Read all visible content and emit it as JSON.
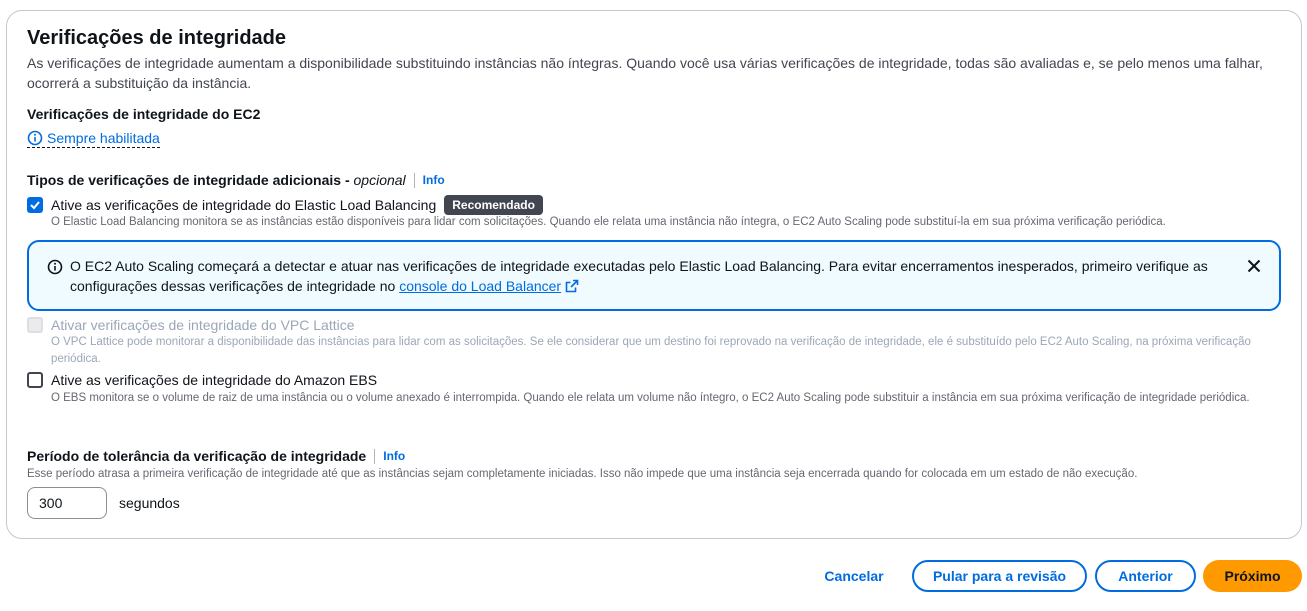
{
  "section": {
    "title": "Verificações de integridade",
    "description": "As verificações de integridade aumentam a disponibilidade substituindo instâncias não íntegras. Quando você usa várias verificações de integridade, todas são avaliadas e, se pelo menos uma falhar, ocorrerá a substituição da instância."
  },
  "ec2": {
    "label": "Verificações de integridade do EC2",
    "status": "Sempre habilitada"
  },
  "additional": {
    "label": "Tipos de verificações de integridade adicionais - ",
    "optional": "opcional",
    "info": "Info"
  },
  "elb": {
    "label": "Ative as verificações de integridade do Elastic Load Balancing",
    "badge": "Recomendado",
    "checked": true,
    "description": "O Elastic Load Balancing monitora se as instâncias estão disponíveis para lidar com solicitações. Quando ele relata uma instância não íntegra, o EC2 Auto Scaling pode substituí-la em sua próxima verificação periódica."
  },
  "alert": {
    "text": "O EC2 Auto Scaling começará a detectar e atuar nas verificações de integridade executadas pelo Elastic Load Balancing. Para evitar encerramentos inesperados, primeiro verifique as configurações dessas verificações de integridade no ",
    "link": "console do Load Balancer"
  },
  "vpc": {
    "label": "Ativar verificações de integridade do VPC Lattice",
    "disabled": true,
    "description": "O VPC Lattice pode monitorar a disponibilidade das instâncias para lidar com as solicitações. Se ele considerar que um destino foi reprovado na verificação de integridade, ele é substituído pelo EC2 Auto Scaling, na próxima verificação periódica."
  },
  "ebs": {
    "label": "Ative as verificações de integridade do Amazon EBS",
    "checked": false,
    "description": "O EBS monitora se o volume de raiz de uma instância ou o volume anexado é interrompida. Quando ele relata um volume não íntegro, o EC2 Auto Scaling pode substituir a instância em sua próxima verificação de integridade periódica."
  },
  "grace": {
    "label": "Período de tolerância da verificação de integridade",
    "info": "Info",
    "description": "Esse período atrasa a primeira verificação de integridade até que as instâncias sejam completamente iniciadas. Isso não impede que uma instância seja encerrada quando for colocada em um estado de não execução.",
    "value": "300",
    "unit": "segundos"
  },
  "footer": {
    "cancel": "Cancelar",
    "skip": "Pular para a revisão",
    "previous": "Anterior",
    "next": "Próximo"
  },
  "colors": {
    "accent": "#006ce0",
    "primary_button": "#ff9900",
    "alert_bg": "#f0fbff"
  }
}
